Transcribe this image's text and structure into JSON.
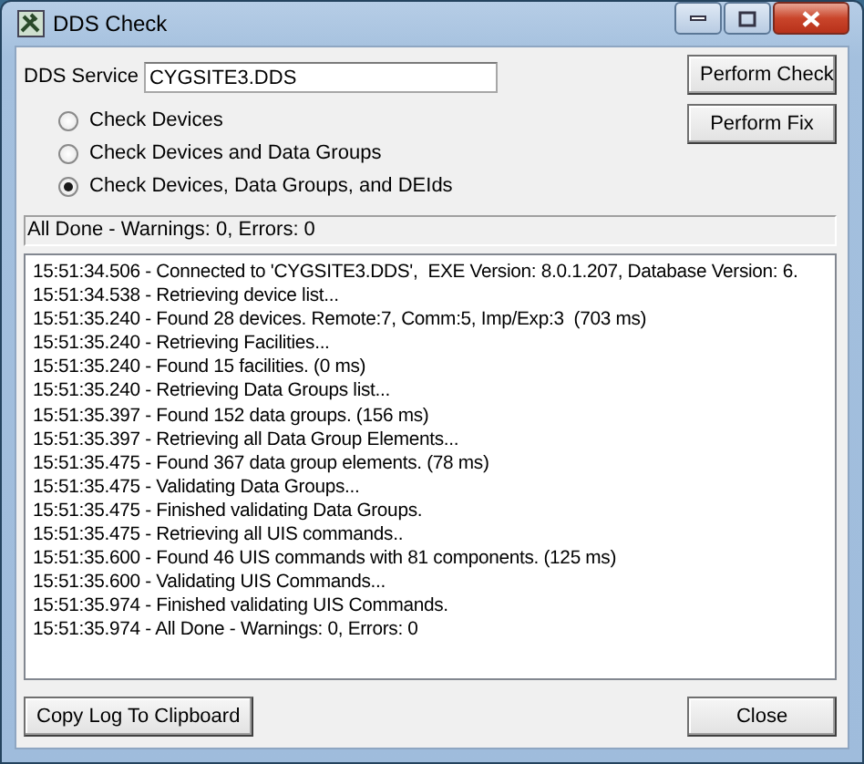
{
  "window": {
    "title": "DDS Check"
  },
  "service": {
    "label": "DDS Service",
    "value": "CYGSITE3.DDS"
  },
  "side_buttons": [
    "Perform Check",
    "Perform Fix"
  ],
  "options": [
    {
      "label": "Check Devices",
      "selected": false
    },
    {
      "label": "Check Devices and Data Groups",
      "selected": false
    },
    {
      "label": "Check Devices, Data Groups, and DEIds",
      "selected": true
    }
  ],
  "status": "All Done - Warnings: 0, Errors: 0",
  "log": [
    "15:51:34.506 - Connected to 'CYGSITE3.DDS',  EXE Version: 8.0.1.207, Database Version: 6.",
    "15:51:34.538 - Retrieving device list...",
    "15:51:35.240 - Found 28 devices. Remote:7, Comm:5, Imp/Exp:3  (703 ms)",
    "15:51:35.240 - Retrieving Facilities...",
    "15:51:35.240 - Found 15 facilities. (0 ms)",
    "15:51:35.240 - Retrieving Data Groups list...",
    "15:51:35.397 - Found 152 data groups. (156 ms)",
    "15:51:35.397 - Retrieving all Data Group Elements...",
    "15:51:35.475 - Found 367 data group elements. (78 ms)",
    "15:51:35.475 - Validating Data Groups...",
    "15:51:35.475 - Finished validating Data Groups.",
    "15:51:35.475 - Retrieving all UIS commands..",
    "15:51:35.600 - Found 46 UIS commands with 81 components. (125 ms)",
    "15:51:35.600 - Validating UIS Commands...",
    "15:51:35.974 - Finished validating UIS Commands.",
    "15:51:35.974 - All Done - Warnings: 0, Errors: 0"
  ],
  "bottom_buttons": [
    "Copy Log To Clipboard",
    "Close"
  ]
}
